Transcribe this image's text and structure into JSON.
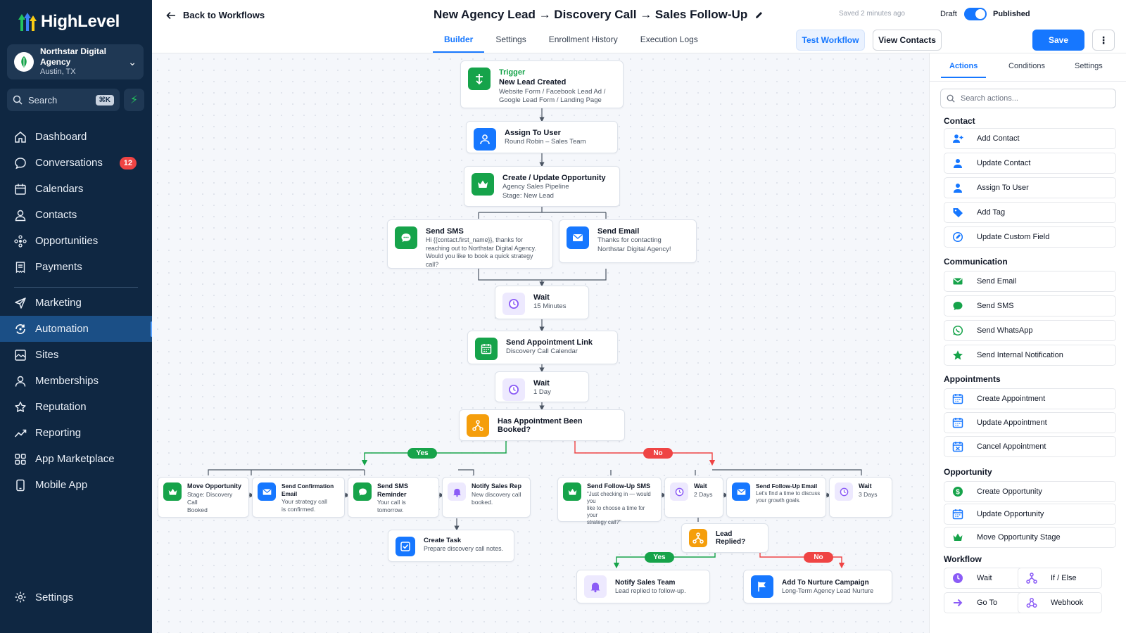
{
  "brand": {
    "name": "HighLevel"
  },
  "account": {
    "name": "Northstar Digital Agency",
    "location": "Austin, TX"
  },
  "search": {
    "label": "Search",
    "shortcut": "⌘K"
  },
  "nav": {
    "items": [
      {
        "label": "Dashboard",
        "icon": "home-icon"
      },
      {
        "label": "Conversations",
        "icon": "chat-icon",
        "badge": "12"
      },
      {
        "label": "Calendars",
        "icon": "calendar-icon"
      },
      {
        "label": "Contacts",
        "icon": "user-icon"
      },
      {
        "label": "Opportunities",
        "icon": "opportunities-icon"
      },
      {
        "label": "Payments",
        "icon": "payments-icon"
      },
      {
        "label": "Marketing",
        "icon": "send-icon"
      },
      {
        "label": "Automation",
        "icon": "automation-icon",
        "active": true
      },
      {
        "label": "Sites",
        "icon": "sites-icon"
      },
      {
        "label": "Memberships",
        "icon": "member-icon"
      },
      {
        "label": "Reputation",
        "icon": "star-icon"
      },
      {
        "label": "Reporting",
        "icon": "trend-icon"
      },
      {
        "label": "App Marketplace",
        "icon": "grid-icon"
      },
      {
        "label": "Mobile App",
        "icon": "phone-icon"
      }
    ],
    "settings": "Settings"
  },
  "header": {
    "back": "Back to Workflows",
    "title": "New Agency Lead → Discovery Call → Sales Follow-Up",
    "saved": "Saved 2 minutes ago",
    "draft": "Draft",
    "published": "Published",
    "tabs": [
      "Builder",
      "Settings",
      "Enrollment History",
      "Execution Logs"
    ],
    "test": "Test Workflow",
    "view_contacts": "View Contacts",
    "save": "Save",
    "more": "⋮"
  },
  "flow": {
    "trigger": {
      "kind": "Trigger",
      "title": "New Lead Created",
      "sub1": "Website Form / Facebook Lead Ad /",
      "sub2": "Google Lead Form / Landing Page"
    },
    "assign": {
      "title": "Assign To User",
      "sub": "Round Robin – Sales Team"
    },
    "opp": {
      "title": "Create / Update Opportunity",
      "sub1": "Agency Sales Pipeline",
      "sub2": "Stage: New Lead"
    },
    "sms": {
      "title": "Send SMS",
      "sub1": "Hi {{contact.first_name}}, thanks for",
      "sub2": "reaching out to Northstar Digital Agency.",
      "sub3": "Would you like to book a quick strategy call?"
    },
    "email": {
      "title": "Send Email",
      "sub1": "Thanks for contacting",
      "sub2": "Northstar Digital Agency!"
    },
    "wait1": {
      "title": "Wait",
      "sub": "15 Minutes"
    },
    "appt": {
      "title": "Send Appointment Link",
      "sub": "Discovery Call Calendar"
    },
    "wait2": {
      "title": "Wait",
      "sub": "1 Day"
    },
    "cond": {
      "title": "Has Appointment Been Booked?"
    },
    "yes": "Yes",
    "no": "No",
    "move": {
      "title": "Move Opportunity",
      "sub1": "Stage: Discovery Call",
      "sub2": "Booked"
    },
    "confirm": {
      "title": "Send Confirmation Email",
      "sub1": "Your strategy call",
      "sub2": "is confirmed."
    },
    "reminder": {
      "title": "Send SMS Reminder",
      "sub": "Your call is tomorrow."
    },
    "notify_rep": {
      "title": "Notify Sales Rep",
      "sub1": "New discovery call",
      "sub2": "booked."
    },
    "task": {
      "title": "Create Task",
      "sub": "Prepare discovery call notes."
    },
    "fu_sms": {
      "title": "Send Follow-Up SMS",
      "sub1": "\"Just checking in — would you",
      "sub2": "like to choose a time for your",
      "sub3": "strategy call?\""
    },
    "wait3": {
      "title": "Wait",
      "sub": "2 Days"
    },
    "fu_email": {
      "title": "Send Follow-Up Email",
      "sub1": "Let's find a time to discuss",
      "sub2": "your growth goals."
    },
    "wait4": {
      "title": "Wait",
      "sub": "3 Days"
    },
    "replied": {
      "title": "Lead Replied?"
    },
    "notify_team": {
      "title": "Notify Sales Team",
      "sub": "Lead replied to follow-up."
    },
    "nurture": {
      "title": "Add To Nurture Campaign",
      "sub": "Long-Term Agency Lead Nurture"
    }
  },
  "panel": {
    "tabs": [
      "Actions",
      "Conditions",
      "Settings"
    ],
    "search_placeholder": "Search actions...",
    "sections": {
      "contact": {
        "title": "Contact",
        "items": [
          "Add Contact",
          "Update Contact",
          "Assign To User",
          "Add Tag",
          "Update Custom Field"
        ]
      },
      "communication": {
        "title": "Communication",
        "items": [
          "Send Email",
          "Send SMS",
          "Send WhatsApp",
          "Send Internal Notification"
        ]
      },
      "appointments": {
        "title": "Appointments",
        "items": [
          "Create Appointment",
          "Update Appointment",
          "Cancel Appointment"
        ]
      },
      "opportunity": {
        "title": "Opportunity",
        "items": [
          "Create Opportunity",
          "Update Opportunity",
          "Move Opportunity Stage"
        ]
      },
      "workflow": {
        "title": "Workflow",
        "items": [
          "Wait",
          "If / Else",
          "Go To",
          "Webhook"
        ]
      }
    }
  },
  "colors": {
    "sidebar": "#0f2742",
    "accent": "#1677ff",
    "green": "#16a34a",
    "purple": "#8b5cf6",
    "orange": "#f59e0b",
    "red": "#ef4444"
  }
}
